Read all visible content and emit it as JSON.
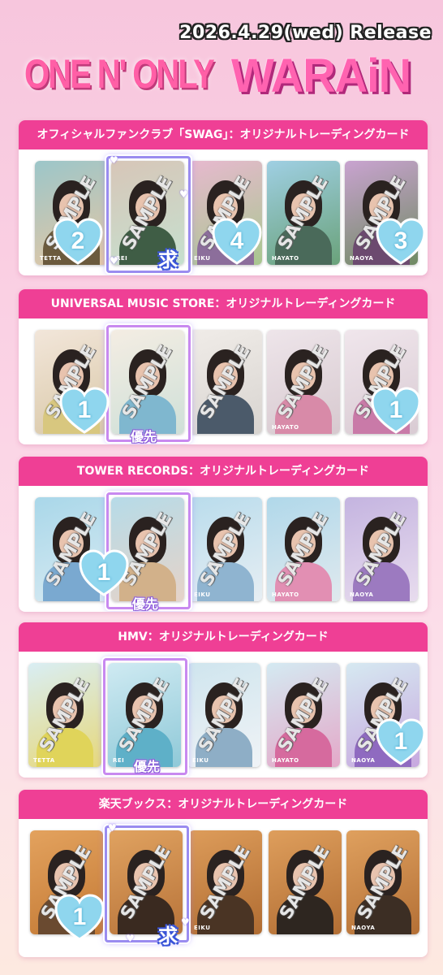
{
  "header": {
    "release": "2026.4.29(wed) Release",
    "artist": "ONE N' ONLY",
    "album": "WARAiN"
  },
  "sections": [
    {
      "title": "オフィシャルファンクラブ「SWAG」：オリジナルトレーディングカード",
      "cards": [
        {
          "name": "TETTA",
          "watermark": "SAMPLE"
        },
        {
          "name": "REI",
          "watermark": "SAMPLE"
        },
        {
          "name": "EIKU",
          "watermark": "SAMPLE"
        },
        {
          "name": "HAYATO",
          "watermark": "SAMPLE"
        },
        {
          "name": "NAOYA",
          "watermark": "SAMPLE"
        }
      ],
      "counts": [
        "2",
        "4",
        "3"
      ],
      "badge": "求"
    },
    {
      "title": "UNIVERSAL MUSIC STORE：オリジナルトレーディングカード",
      "cards": [
        {
          "name": "",
          "watermark": "SAMPLE"
        },
        {
          "name": "",
          "watermark": "SAMPLE"
        },
        {
          "name": "",
          "watermark": "SAMPLE"
        },
        {
          "name": "HAYATO",
          "watermark": "SAMPLE"
        },
        {
          "name": "",
          "watermark": "SAMPLE"
        }
      ],
      "counts": [
        "1",
        "1"
      ],
      "badge": "優先"
    },
    {
      "title": "TOWER RECORDS：オリジナルトレーディングカード",
      "cards": [
        {
          "name": "",
          "watermark": "SAMPLE"
        },
        {
          "name": "",
          "watermark": "SAMPLE"
        },
        {
          "name": "EIKU",
          "watermark": "SAMPLE"
        },
        {
          "name": "HAYATO",
          "watermark": "SAMPLE"
        },
        {
          "name": "NAOYA",
          "watermark": "SAMPLE"
        }
      ],
      "counts": [
        "1"
      ],
      "badge": "優先"
    },
    {
      "title": "HMV：オリジナルトレーディングカード",
      "cards": [
        {
          "name": "TETTA",
          "watermark": "SAMPLE"
        },
        {
          "name": "REI",
          "watermark": "SAMPLE"
        },
        {
          "name": "EIKU",
          "watermark": "SAMPLE"
        },
        {
          "name": "HAYATO",
          "watermark": "SAMPLE"
        },
        {
          "name": "NAOYA",
          "watermark": "SAMPLE"
        }
      ],
      "counts": [
        "1"
      ],
      "badge": "優先"
    },
    {
      "title": "楽天ブックス：オリジナルトレーディングカード",
      "cards": [
        {
          "name": "",
          "watermark": "SAMPLE"
        },
        {
          "name": "",
          "watermark": "SAMPLE"
        },
        {
          "name": "EIKU",
          "watermark": "SAMPLE"
        },
        {
          "name": "",
          "watermark": "SAMPLE"
        },
        {
          "name": "NAOYA",
          "watermark": "SAMPLE"
        }
      ],
      "counts": [
        "1"
      ],
      "badge": "求"
    }
  ],
  "colors": {
    "section_header": "#ef3f95",
    "heart": "#8fd6ee",
    "frame_blue": "#9a8cf0",
    "frame_purple": "#c889f0"
  }
}
